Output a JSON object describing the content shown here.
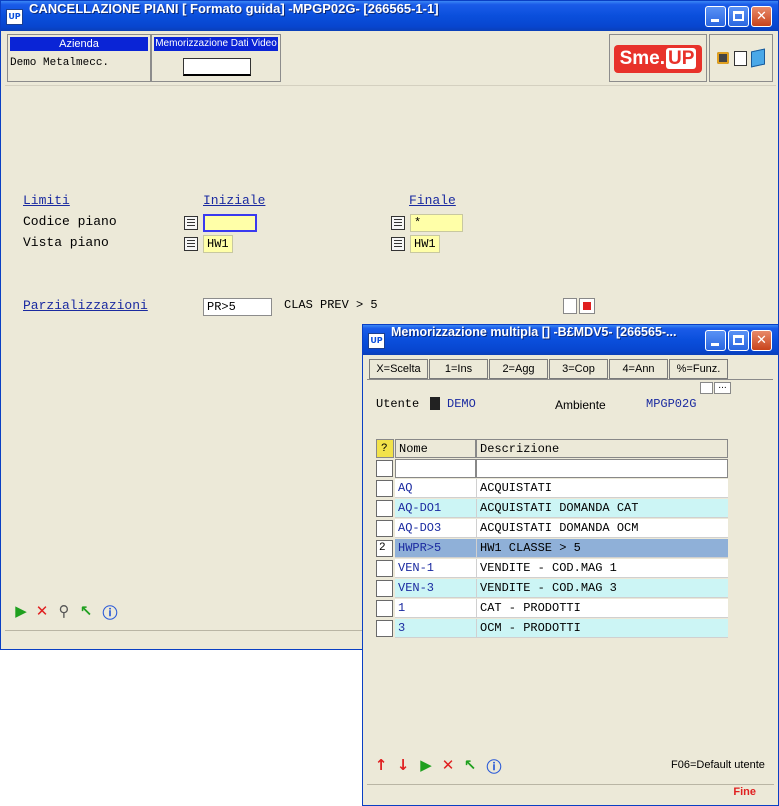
{
  "main": {
    "title": "CANCELLAZIONE PIANI [ Formato guida] -MPGP02G- [266565-1-1]",
    "app_icon": "UP",
    "header": {
      "azienda_caption": "Azienda",
      "azienda_value": "Demo Metalmecc.",
      "memo_caption": "Memorizzazione Dati Video",
      "logo_text_left": "Sme.",
      "logo_text_right": "UP"
    },
    "form": {
      "limiti": "Limiti",
      "iniziale": "Iniziale",
      "finale": "Finale",
      "codice_piano_label": "Codice piano",
      "codice_piano_start": "",
      "codice_piano_end": "*",
      "vista_piano_label": "Vista piano",
      "vista_piano_start": "HW1",
      "vista_piano_end": "HW1",
      "parzializzazioni_label": "Parzializzazioni",
      "parzializzazioni_value": "PR>5",
      "parzializzazioni_desc": "CLAS PREV > 5"
    }
  },
  "popup": {
    "title": "Memorizzazione multipla [] -B£MDV5- [266565-...",
    "app_icon": "UP",
    "buttons": [
      "X=Scelta",
      "1=Ins",
      "2=Agg",
      "3=Cop",
      "4=Ann",
      "%=Funz."
    ],
    "utente_label": "Utente",
    "utente_value": "DEMO",
    "ambiente_label": "Ambiente",
    "ambiente_value": "MPGP02G",
    "grid": {
      "headers": [
        "?",
        "Nome",
        "Descrizione"
      ],
      "rows": [
        {
          "sel": "",
          "nome": "AQ",
          "desc": "ACQUISTATI"
        },
        {
          "sel": "",
          "nome": "AQ-DO1",
          "desc": "ACQUISTATI DOMANDA CAT"
        },
        {
          "sel": "",
          "nome": "AQ-DO3",
          "desc": "ACQUISTATI DOMANDA OCM"
        },
        {
          "sel": "2",
          "nome": "HWPR>5",
          "desc": "HW1 CLASSE > 5"
        },
        {
          "sel": "",
          "nome": "VEN-1",
          "desc": "VENDITE - COD.MAG 1"
        },
        {
          "sel": "",
          "nome": "VEN-3",
          "desc": "VENDITE - COD.MAG 3"
        },
        {
          "sel": "",
          "nome": "1",
          "desc": "CAT - PRODOTTI"
        },
        {
          "sel": "",
          "nome": "3",
          "desc": "OCM - PRODOTTI"
        }
      ]
    },
    "footer_hint": "F06=Default utente",
    "status": "Fine"
  },
  "colors": {
    "row_odd": "#ffffff",
    "row_even": "#ccf5f5",
    "row_selected": "#8fb0d8",
    "field_yellow": "#ffffa8",
    "link_blue": "#1a2aa0",
    "titlebar_blue": "#0a4fdc"
  }
}
